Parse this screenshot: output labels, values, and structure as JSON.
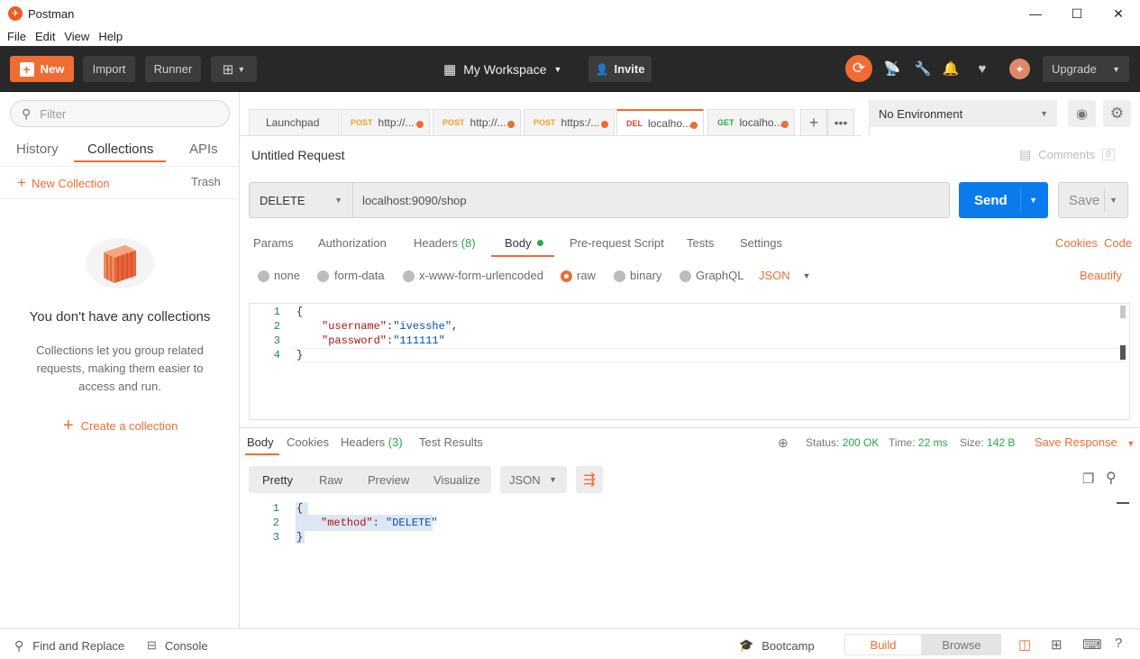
{
  "window": {
    "title": "Postman",
    "minimize": "—",
    "maximize": "☐",
    "close": "✕"
  },
  "menu": [
    "File",
    "Edit",
    "View",
    "Help"
  ],
  "header": {
    "new_label": "New",
    "import_label": "Import",
    "runner_label": "Runner",
    "workspace_label": "My Workspace",
    "invite_label": "Invite",
    "upgrade_label": "Upgrade"
  },
  "sidebar": {
    "filter_placeholder": "Filter",
    "tabs": [
      "History",
      "Collections",
      "APIs"
    ],
    "active_tab": "Collections",
    "new_collection_label": "New Collection",
    "trash_label": "Trash",
    "empty_title": "You don't have any collections",
    "empty_desc_line1": "Collections let you group related",
    "empty_desc_line2": "requests, making them easier to",
    "empty_desc_line3": "access and run.",
    "create_label": "Create a collection"
  },
  "request_tabs": [
    {
      "method": "",
      "label": "Launchpad"
    },
    {
      "method": "POST",
      "label": "http://..."
    },
    {
      "method": "POST",
      "label": "http://..."
    },
    {
      "method": "POST",
      "label": "https:/..."
    },
    {
      "method": "DEL",
      "label": "localho..."
    },
    {
      "method": "GET",
      "label": "localho..."
    }
  ],
  "environment": {
    "selected": "No Environment"
  },
  "request": {
    "name": "Untitled Request",
    "comments_label": "Comments",
    "comments_count": "0",
    "method": "DELETE",
    "url": "localhost:9090/shop",
    "send_label": "Send",
    "save_label": "Save"
  },
  "request_subtabs": {
    "params": "Params",
    "authorization": "Authorization",
    "headers": "Headers",
    "headers_count": "(8)",
    "body": "Body",
    "prerequest": "Pre-request Script",
    "tests": "Tests",
    "settings": "Settings",
    "cookies": "Cookies",
    "code": "Code"
  },
  "body_options": {
    "none": "none",
    "form_data": "form-data",
    "urlencoded": "x-www-form-urlencoded",
    "raw": "raw",
    "binary": "binary",
    "graphql": "GraphQL",
    "format": "JSON",
    "beautify": "Beautify"
  },
  "request_body": {
    "line_numbers": [
      "1",
      "2",
      "3",
      "4"
    ],
    "l1": "{",
    "l2_key": "\"username\"",
    "l2_val": "\"ivesshe\"",
    "l3_key": "\"password\"",
    "l3_val": "\"111111\"",
    "l4": "}"
  },
  "response": {
    "tabs": {
      "body": "Body",
      "cookies": "Cookies",
      "headers": "Headers",
      "headers_count": "(3)",
      "test_results": "Test Results"
    },
    "status_label": "Status:",
    "status_value": "200 OK",
    "time_label": "Time:",
    "time_value": "22 ms",
    "size_label": "Size:",
    "size_value": "142 B",
    "save_response": "Save Response",
    "view_tabs": [
      "Pretty",
      "Raw",
      "Preview",
      "Visualize"
    ],
    "format": "JSON",
    "line_numbers": [
      "1",
      "2",
      "3"
    ],
    "l1": "{",
    "l2_key": "\"method\"",
    "l2_val": "\"DELETE\"",
    "l3": "}"
  },
  "footer": {
    "find_replace": "Find and Replace",
    "console": "Console",
    "bootcamp": "Bootcamp",
    "build": "Build",
    "browse": "Browse"
  },
  "colors": {
    "accent": "#ef6c33",
    "send": "#097bed",
    "header": "#282828",
    "status_ok": "#2aa745"
  }
}
